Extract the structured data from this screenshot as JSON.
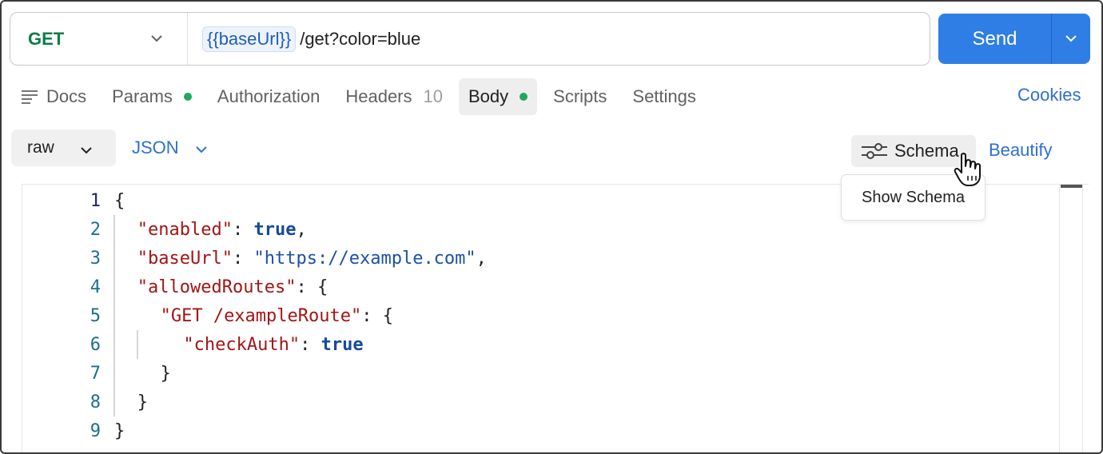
{
  "request": {
    "method": "GET",
    "url_variable": "{{baseUrl}}",
    "url_path": "/get?color=blue",
    "send_label": "Send"
  },
  "tabs": [
    {
      "label": "Docs",
      "icon": "docs-lines-icon"
    },
    {
      "label": "Params",
      "indicator": "green-dot"
    },
    {
      "label": "Authorization"
    },
    {
      "label": "Headers",
      "count": "10"
    },
    {
      "label": "Body",
      "indicator": "green-dot",
      "active": true
    },
    {
      "label": "Scripts"
    },
    {
      "label": "Settings"
    }
  ],
  "cookies_label": "Cookies",
  "body_toolbar": {
    "mode": "raw",
    "language": "JSON",
    "schema_label": "Schema",
    "beautify_label": "Beautify",
    "tooltip": "Show Schema"
  },
  "editor": {
    "line_numbers": [
      "1",
      "2",
      "3",
      "4",
      "5",
      "6",
      "7",
      "8",
      "9"
    ],
    "lines": [
      {
        "tokens": [
          {
            "t": "p",
            "v": "{"
          }
        ]
      },
      {
        "tokens": [
          {
            "t": "k",
            "v": "\"enabled\""
          },
          {
            "t": "p",
            "v": ": "
          },
          {
            "t": "b",
            "v": "true"
          },
          {
            "t": "p",
            "v": ","
          }
        ]
      },
      {
        "tokens": [
          {
            "t": "k",
            "v": "\"baseUrl\""
          },
          {
            "t": "p",
            "v": ": "
          },
          {
            "t": "s",
            "v": "\"https://example.com\""
          },
          {
            "t": "p",
            "v": ","
          }
        ]
      },
      {
        "tokens": [
          {
            "t": "k",
            "v": "\"allowedRoutes\""
          },
          {
            "t": "p",
            "v": ": {"
          }
        ]
      },
      {
        "tokens": [
          {
            "t": "k",
            "v": "\"GET /exampleRoute\""
          },
          {
            "t": "p",
            "v": ": {"
          }
        ]
      },
      {
        "tokens": [
          {
            "t": "k",
            "v": "\"checkAuth\""
          },
          {
            "t": "p",
            "v": ": "
          },
          {
            "t": "b",
            "v": "true"
          }
        ]
      },
      {
        "tokens": [
          {
            "t": "p",
            "v": "}"
          }
        ]
      },
      {
        "tokens": [
          {
            "t": "p",
            "v": "}"
          }
        ]
      },
      {
        "tokens": [
          {
            "t": "p",
            "v": "}"
          }
        ]
      }
    ]
  },
  "colors": {
    "accent": "#2f7ee6",
    "link": "#2f6fd0",
    "method_get": "#0a7d48",
    "indicator_dot": "#1fa860",
    "json_key": "#a31515",
    "json_string": "#1d4fa6",
    "json_boolean": "#154a9c"
  }
}
